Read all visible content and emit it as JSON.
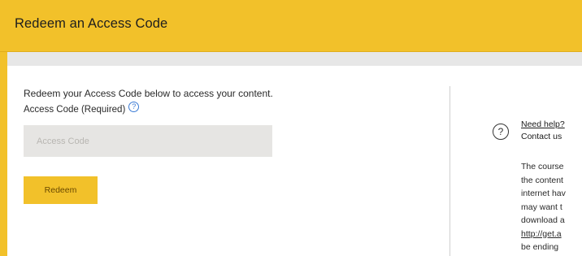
{
  "header": {
    "title": "Redeem an Access Code"
  },
  "form": {
    "intro": "Redeem your Access Code below to access your content.",
    "label": "Access Code (Required)",
    "placeholder": "Access Code",
    "button_label": "Redeem"
  },
  "help": {
    "icon_glyph": "?",
    "need_help": "Need help?",
    "contact": "Contact us",
    "lines": [
      "The course",
      "the content",
      "internet hav",
      "may want t",
      "download a",
      "http://get.a",
      "be ending"
    ]
  },
  "icons": {
    "small_help": "question-circle-icon",
    "large_help": "question-circle-icon"
  },
  "colors": {
    "brand": "#f2c12a",
    "link": "#3a7bd5",
    "input_bg": "#e6e5e3"
  }
}
